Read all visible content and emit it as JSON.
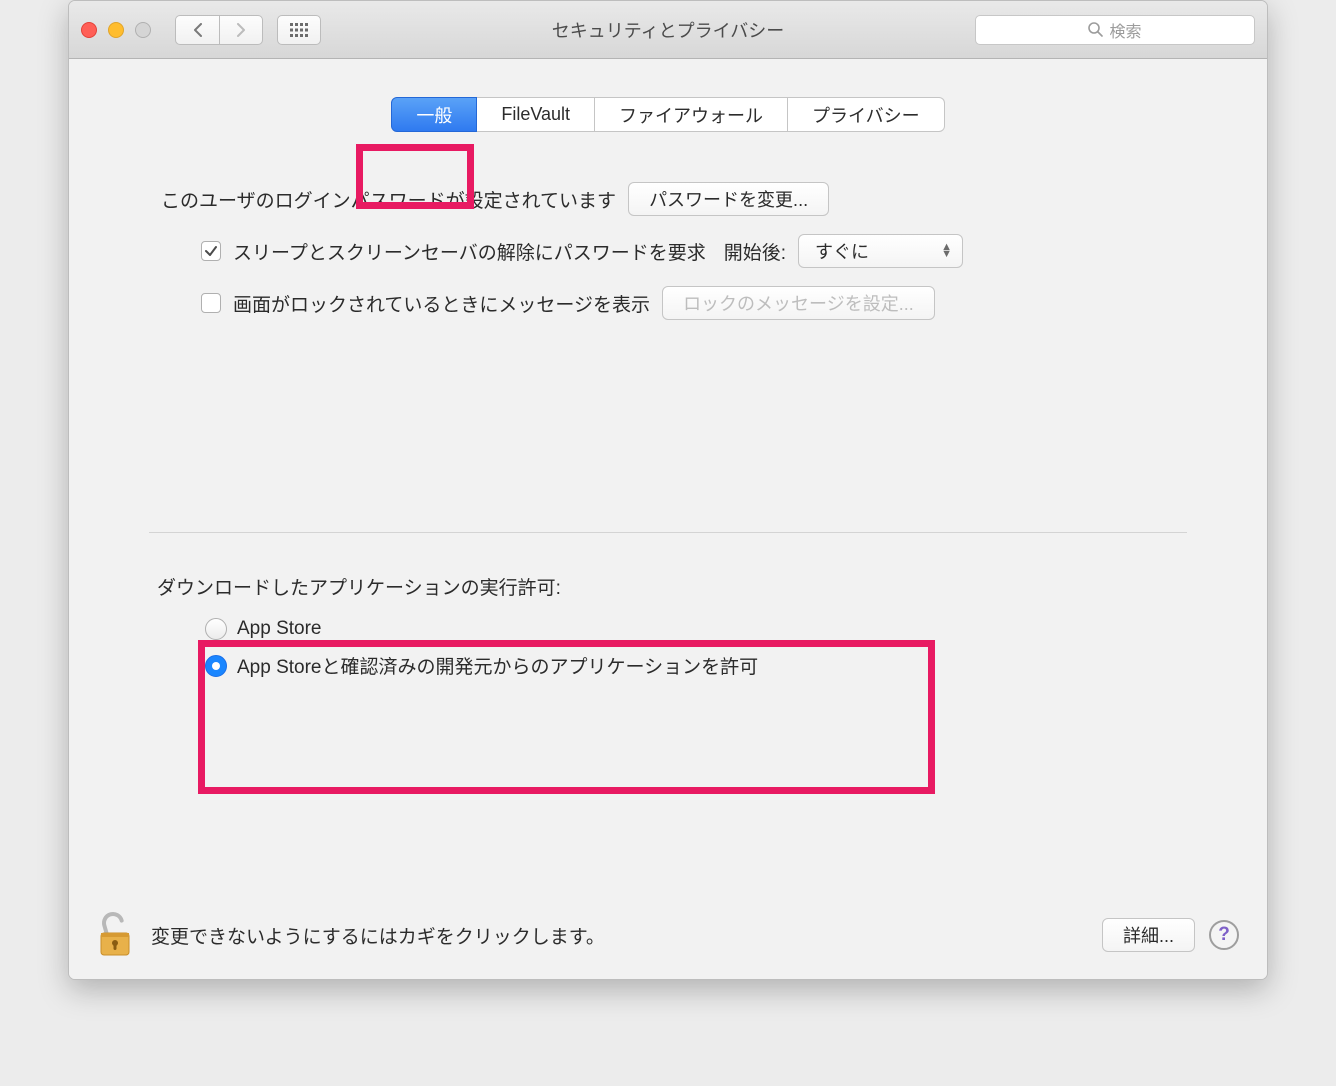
{
  "window": {
    "title": "セキュリティとプライバシー",
    "search_placeholder": "検索"
  },
  "tabs": {
    "general": "一般",
    "filevault": "FileVault",
    "firewall": "ファイアウォール",
    "privacy": "プライバシー"
  },
  "general": {
    "login_password_set": "このユーザのログインパスワードが設定されています",
    "change_password_button": "パスワードを変更...",
    "require_password_label": "スリープとスクリーンセーバの解除にパスワードを要求",
    "require_password_after_label": "開始後:",
    "require_password_delay_value": "すぐに",
    "show_lock_message_label": "画面がロックされているときにメッセージを表示",
    "set_lock_message_button": "ロックのメッセージを設定...",
    "allow_apps_label": "ダウンロードしたアプリケーションの実行許可:",
    "radio_appstore": "App Store",
    "radio_appstore_and_identified": "App Storeと確認済みの開発元からのアプリケーションを許可"
  },
  "footer": {
    "lock_text": "変更できないようにするにはカギをクリックします。",
    "advanced_button": "詳細...",
    "help_label": "?"
  }
}
